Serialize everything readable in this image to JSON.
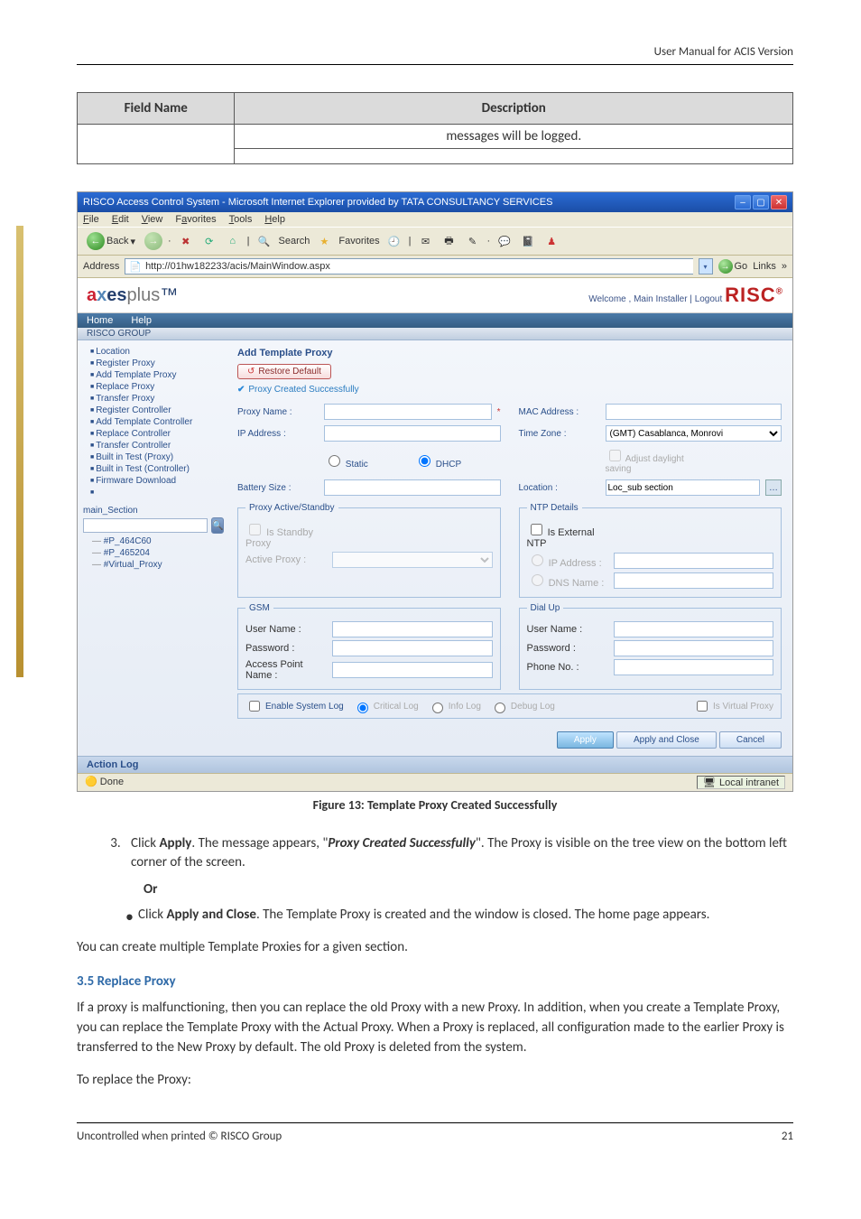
{
  "header": {
    "title": "User Manual for ACIS Version"
  },
  "table": {
    "headers": {
      "field": "Field Name",
      "desc": "Description"
    },
    "msg": "messages will be logged."
  },
  "ie": {
    "title": "RISCO Access Control System - Microsoft Internet Explorer provided by TATA CONSULTANCY SERVICES",
    "menus": {
      "file": "File",
      "edit": "Edit",
      "view": "View",
      "favorites": "Favorites",
      "tools": "Tools",
      "help": "Help"
    },
    "toolbar": {
      "back": "Back",
      "search": "Search",
      "favorites": "Favorites"
    },
    "address_label": "Address",
    "url": "http://01hw182233/acis/MainWindow.aspx",
    "go": "Go",
    "links": "Links",
    "status_done": "Done",
    "status_zone": "Local intranet"
  },
  "app": {
    "brand_a": "a",
    "brand_x": "x",
    "brand_es": "es",
    "brand_plus": "plus",
    "brand_tm": "™",
    "welcome_prefix": "Welcome ,  Main Installer  |  ",
    "logout": "Logout",
    "risco": "RISC",
    "risco_reg": "®",
    "nav": {
      "home": "Home",
      "help": "Help"
    },
    "group": "RISCO GROUP",
    "sidebar": {
      "items": [
        "Location",
        "Register Proxy",
        "Add Template Proxy",
        "Replace Proxy",
        "Transfer Proxy",
        "Register Controller",
        "Add Template Controller",
        "Replace Controller",
        "Transfer Controller",
        "Built in Test (Proxy)",
        "Built in Test (Controller)",
        "Firmware Download"
      ],
      "tree_title": "main_Section",
      "tree": {
        "n1": "#P_464C60",
        "n2": "#P_465204",
        "n3": "#Virtual_Proxy"
      }
    },
    "panel": {
      "title": "Add Template Proxy",
      "restore": "Restore Default",
      "success": "Proxy Created Successfully",
      "labels": {
        "proxy_name": "Proxy Name :",
        "mac": "MAC Address :",
        "ip": "IP Address :",
        "tz": "Time Zone :",
        "tz_val": "(GMT) Casablanca, Monrovi",
        "static": "Static",
        "dhcp": "DHCP",
        "daylight": "Adjust daylight saving",
        "battery": "Battery Size :",
        "location": "Location :",
        "loc_val": "Loc_sub section",
        "pas_legend": "Proxy Active/Standby",
        "is_standby": "Is Standby Proxy",
        "active_proxy": "Active Proxy :",
        "ntp_legend": "NTP Details",
        "is_ext_ntp": "Is External NTP",
        "ntp_ip": "IP Address :",
        "ntp_dns": "DNS Name :",
        "gsm_legend": "GSM",
        "gsm_user": "User Name :",
        "gsm_pass": "Password :",
        "gsm_apn": "Access Point Name :",
        "dial_legend": "Dial Up",
        "dial_user": "User Name :",
        "dial_pass": "Password :",
        "dial_phone": "Phone No. :",
        "enable_log": "Enable System Log",
        "critical": "Critical Log",
        "info": "Info Log",
        "debug": "Debug Log",
        "virt": "Is Virtual Proxy"
      },
      "buttons": {
        "apply": "Apply",
        "apply_close": "Apply and Close",
        "cancel": "Cancel"
      }
    },
    "action_log": "Action Log"
  },
  "figure_caption": "Figure 13: Template Proxy Created Successfully",
  "step3_pre": "Click ",
  "step3_apply": "Apply",
  "step3_mid": ". The message appears, \"",
  "step3_em": "Proxy Created Successfully",
  "step3_post": "\". The Proxy is visible on the tree view on the bottom left corner of the screen.",
  "or": "Or",
  "bullet_pre": "Click ",
  "bullet_ac": "Apply and Close",
  "bullet_post": ". The Template Proxy is created and the window is closed. The home page appears.",
  "multi": "You can create multiple Template Proxies for a given section.",
  "sec35": "3.5  Replace Proxy",
  "p35a": "If a proxy is malfunctioning, then you can replace the old Proxy with a new Proxy. In addition, when you create a Template Proxy, you can replace the Template Proxy with the Actual Proxy. When a Proxy is replaced, all configuration made to the earlier Proxy is transferred to the New Proxy by default. The old Proxy is deleted from the system.",
  "p35b": "To replace the Proxy:",
  "footer": {
    "left": "Uncontrolled when printed © RISCO Group",
    "right": "21"
  }
}
